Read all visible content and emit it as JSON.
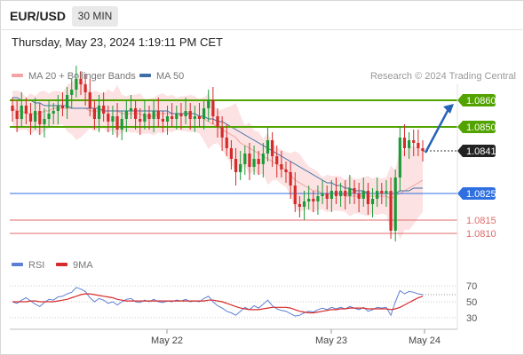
{
  "header": {
    "symbol": "EUR/USD",
    "timeframe": "30 MIN",
    "datetime": "Thursday, May 23, 2024 1:19:11 PM CET"
  },
  "legend_main": [
    {
      "label": "MA 20 + Bollinger Bands",
      "color": "#f4a3a3"
    },
    {
      "label": "MA 50",
      "color": "#3d6ea8"
    }
  ],
  "credit": "Research © 2024 Trading Central",
  "legend_rsi": [
    {
      "label": "RSI",
      "color": "#5b7fd4"
    },
    {
      "label": "9MA",
      "color": "#d62b2b"
    }
  ],
  "colors": {
    "up": "#1b9b37",
    "down": "#d42b2b",
    "resistance": "#52a300",
    "pivot": "#2f6fe0",
    "support": "#e06a6a",
    "current": "#222222",
    "arrow": "#2563b8"
  },
  "chart_data": [
    {
      "type": "candlestick",
      "title": "EUR/USD 30 MIN",
      "x_ticks": [
        "May 22",
        "May 23",
        "May 24"
      ],
      "ylim": [
        1.0805,
        1.0866
      ],
      "grid": false,
      "legend_position": "top-left",
      "levels": [
        {
          "value": 1.086,
          "label": "1.0860",
          "kind": "resistance"
        },
        {
          "value": 1.085,
          "label": "1.0850",
          "kind": "resistance"
        },
        {
          "value": 1.0841,
          "label": "1.0841",
          "kind": "current"
        },
        {
          "value": 1.0825,
          "label": "1.0825",
          "kind": "pivot"
        },
        {
          "value": 1.0815,
          "label": "1.0815",
          "kind": "support"
        },
        {
          "value": 1.081,
          "label": "1.0810",
          "kind": "support"
        }
      ],
      "close": [
        1.0856,
        1.0853,
        1.0858,
        1.0855,
        1.0852,
        1.0856,
        1.0851,
        1.0853,
        1.0855,
        1.0856,
        1.0858,
        1.0857,
        1.0862,
        1.0864,
        1.0868,
        1.0866,
        1.0863,
        1.0857,
        1.0853,
        1.0858,
        1.0855,
        1.0852,
        1.0854,
        1.0849,
        1.0853,
        1.0856,
        1.0857,
        1.0853,
        1.0852,
        1.0855,
        1.0853,
        1.0856,
        1.0853,
        1.0852,
        1.0854,
        1.0853,
        1.0855,
        1.0854,
        1.0856,
        1.0853,
        1.0854,
        1.0853,
        1.0857,
        1.086,
        1.0854,
        1.085,
        1.0846,
        1.0842,
        1.0838,
        1.0833,
        1.0836,
        1.084,
        1.0835,
        1.0838,
        1.0836,
        1.084,
        1.0845,
        1.0839,
        1.0836,
        1.0834,
        1.0833,
        1.0828,
        1.0821,
        1.082,
        1.0822,
        1.0823,
        1.0822,
        1.0824,
        1.0825,
        1.0823,
        1.0826,
        1.0824,
        1.0826,
        1.0824,
        1.0827,
        1.0825,
        1.0823,
        1.0826,
        1.0821,
        1.0823,
        1.0826,
        1.0825,
        1.0826,
        1.0811,
        1.0831,
        1.0846,
        1.0842,
        1.0845,
        1.0844,
        1.0842,
        1.0841
      ],
      "ma20": [
        1.0857,
        1.0856,
        1.0856,
        1.0855,
        1.0855,
        1.0855,
        1.0855,
        1.0856,
        1.0856,
        1.0857,
        1.0857,
        1.0857,
        1.0857,
        1.0857,
        1.0857,
        1.0857,
        1.0857,
        1.0856,
        1.0856,
        1.0856,
        1.0856,
        1.0856,
        1.0856,
        1.0856,
        1.0855,
        1.0855,
        1.0855,
        1.0855,
        1.0855,
        1.0854,
        1.0854,
        1.0854,
        1.0855,
        1.0855,
        1.0855,
        1.0855,
        1.0855,
        1.0855,
        1.0855,
        1.0855,
        1.0855,
        1.0854,
        1.0853,
        1.0852,
        1.0851,
        1.085,
        1.0849,
        1.0848,
        1.0847,
        1.0846,
        1.0844,
        1.0843,
        1.0842,
        1.0841,
        1.084,
        1.0839,
        1.0838,
        1.0837,
        1.0836,
        1.0835,
        1.0834,
        1.0832,
        1.083,
        1.0829,
        1.0828,
        1.0827,
        1.0826,
        1.0826,
        1.0825,
        1.0825,
        1.0825,
        1.0825,
        1.0825,
        1.0824,
        1.0824,
        1.0824,
        1.0824,
        1.0824,
        1.0824,
        1.0824,
        1.0824,
        1.0824,
        1.0824,
        1.0823,
        1.0824,
        1.0825,
        1.0826,
        1.0827,
        1.0828,
        1.0829,
        1.083
      ],
      "ma50": [
        1.0861,
        1.0861,
        1.086,
        1.086,
        1.086,
        1.0859,
        1.0859,
        1.0858,
        1.0858,
        1.0858,
        1.0858,
        1.0858,
        1.0858,
        1.0857,
        1.0857,
        1.0857,
        1.0857,
        1.0857,
        1.0857,
        1.0857,
        1.0856,
        1.0856,
        1.0856,
        1.0856,
        1.0856,
        1.0856,
        1.0856,
        1.0856,
        1.0856,
        1.0856,
        1.0856,
        1.0856,
        1.0856,
        1.0856,
        1.0856,
        1.0855,
        1.0855,
        1.0855,
        1.0855,
        1.0855,
        1.0855,
        1.0854,
        1.0854,
        1.0853,
        1.0853,
        1.0852,
        1.0852,
        1.0851,
        1.085,
        1.0849,
        1.0848,
        1.0847,
        1.0846,
        1.0845,
        1.0844,
        1.0843,
        1.0842,
        1.0841,
        1.084,
        1.0839,
        1.0838,
        1.0837,
        1.0836,
        1.0835,
        1.0834,
        1.0833,
        1.0832,
        1.0831,
        1.083,
        1.0829,
        1.0829,
        1.0828,
        1.0828,
        1.0827,
        1.0827,
        1.0826,
        1.0826,
        1.0826,
        1.0825,
        1.0825,
        1.0825,
        1.0825,
        1.0825,
        1.0825,
        1.0825,
        1.0826,
        1.0826,
        1.0826,
        1.0827,
        1.0827,
        1.0827
      ]
    },
    {
      "type": "line",
      "title": "",
      "x_ticks": [
        "May 22",
        "May 23",
        "May 24"
      ],
      "ylim": [
        22,
        78
      ],
      "y_ticks": [
        70,
        50,
        30
      ],
      "grid": false,
      "rsi": [
        50,
        48,
        52,
        55,
        51,
        47,
        44,
        49,
        53,
        52,
        56,
        57,
        60,
        62,
        68,
        66,
        63,
        55,
        50,
        54,
        52,
        48,
        50,
        46,
        50,
        53,
        54,
        50,
        49,
        52,
        50,
        53,
        50,
        49,
        51,
        50,
        52,
        51,
        53,
        50,
        51,
        50,
        54,
        57,
        50,
        45,
        42,
        38,
        36,
        33,
        38,
        43,
        40,
        45,
        42,
        47,
        52,
        45,
        41,
        39,
        38,
        35,
        32,
        33,
        36,
        38,
        37,
        40,
        42,
        40,
        43,
        41,
        43,
        41,
        44,
        42,
        40,
        43,
        38,
        40,
        43,
        42,
        43,
        33,
        50,
        64,
        60,
        63,
        62,
        60,
        59
      ],
      "ma9": [
        50,
        50,
        50,
        50,
        51,
        51,
        50,
        50,
        50,
        50,
        51,
        52,
        53,
        55,
        57,
        59,
        60,
        60,
        59,
        58,
        57,
        56,
        55,
        53,
        52,
        51,
        51,
        51,
        51,
        51,
        51,
        51,
        51,
        51,
        51,
        51,
        51,
        51,
        51,
        51,
        51,
        51,
        51,
        52,
        52,
        51,
        50,
        48,
        46,
        44,
        42,
        41,
        40,
        40,
        40,
        41,
        42,
        43,
        43,
        43,
        43,
        42,
        40,
        38,
        37,
        36,
        36,
        37,
        38,
        39,
        40,
        40,
        41,
        41,
        42,
        42,
        42,
        42,
        41,
        41,
        41,
        41,
        41,
        40,
        41,
        43,
        46,
        49,
        52,
        55,
        57
      ]
    }
  ]
}
